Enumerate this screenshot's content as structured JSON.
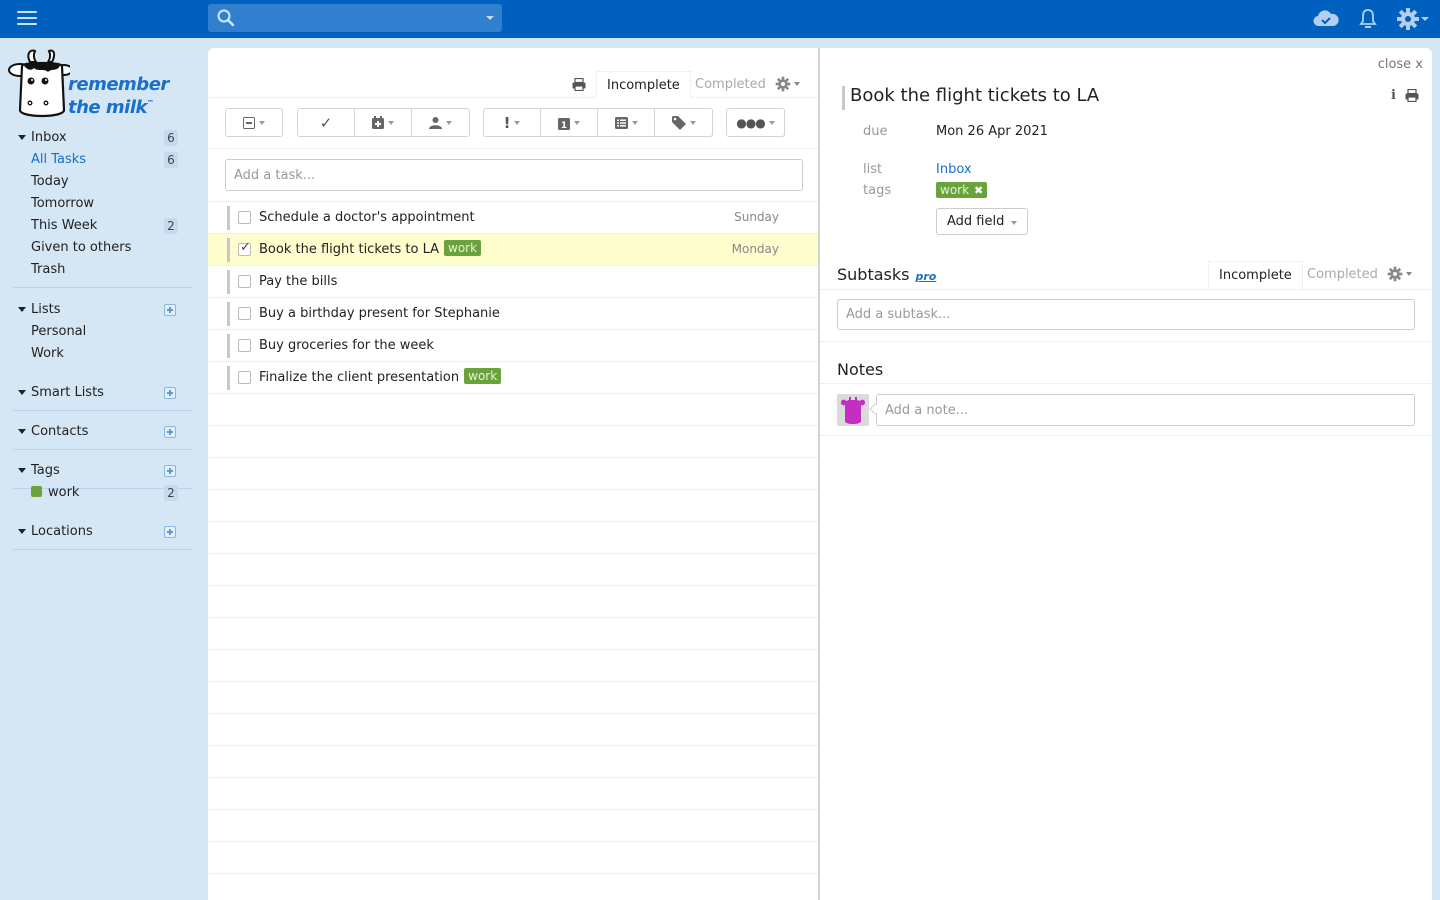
{
  "topbar": {
    "search_placeholder": "",
    "icons": [
      "menu-icon",
      "search-icon",
      "cloud-sync-icon",
      "bell-icon",
      "gear-icon"
    ]
  },
  "brand": {
    "line1": "remember",
    "line2": "the milk",
    "tm": "™"
  },
  "sidebar": {
    "inbox": {
      "label": "Inbox",
      "count": "6",
      "items": [
        {
          "label": "All Tasks",
          "count": "6",
          "active": true
        },
        {
          "label": "Today",
          "count": ""
        },
        {
          "label": "Tomorrow",
          "count": ""
        },
        {
          "label": "This Week",
          "count": "2"
        },
        {
          "label": "Given to others",
          "count": ""
        },
        {
          "label": "Trash",
          "count": ""
        }
      ]
    },
    "lists": {
      "label": "Lists",
      "items": [
        {
          "label": "Personal"
        },
        {
          "label": "Work"
        }
      ]
    },
    "smart_lists": {
      "label": "Smart Lists"
    },
    "contacts": {
      "label": "Contacts"
    },
    "tags": {
      "label": "Tags",
      "items": [
        {
          "label": "work",
          "count": "2",
          "color": "#6aa33b"
        }
      ]
    },
    "locations": {
      "label": "Locations"
    }
  },
  "main": {
    "tabs": {
      "incomplete": "Incomplete",
      "completed": "Completed"
    },
    "add_task_placeholder": "Add a task...",
    "tasks": [
      {
        "name": "Schedule a doctor's appointment",
        "tag": "",
        "due": "Sunday",
        "checked": false
      },
      {
        "name": "Book the flight tickets to LA",
        "tag": "work",
        "due": "Monday",
        "checked": true
      },
      {
        "name": "Pay the bills",
        "tag": "",
        "due": "",
        "checked": false
      },
      {
        "name": "Buy a birthday present for Stephanie",
        "tag": "",
        "due": "",
        "checked": false
      },
      {
        "name": "Buy groceries for the week",
        "tag": "",
        "due": "",
        "checked": false
      },
      {
        "name": "Finalize the client presentation",
        "tag": "work",
        "due": "",
        "checked": false
      }
    ]
  },
  "detail": {
    "close_label": "close x",
    "title": "Book the flight tickets to LA",
    "fields": {
      "due_label": "due",
      "due_value": "Mon 26 Apr 2021",
      "list_label": "list",
      "list_value": "Inbox",
      "tags_label": "tags",
      "tag_value": "work"
    },
    "add_field_label": "Add field",
    "subtasks": {
      "title": "Subtasks",
      "pro": "pro",
      "tab_incomplete": "Incomplete",
      "tab_completed": "Completed",
      "placeholder": "Add a subtask..."
    },
    "notes": {
      "title": "Notes",
      "placeholder": "Add a note..."
    }
  },
  "colors": {
    "topbar": "#0060bf",
    "sidebar": "#d5e6f5",
    "accent": "#1a6fc9",
    "tag": "#6aa33b",
    "selected_row": "#fdfdcd",
    "avatar": "#c42ec2"
  }
}
